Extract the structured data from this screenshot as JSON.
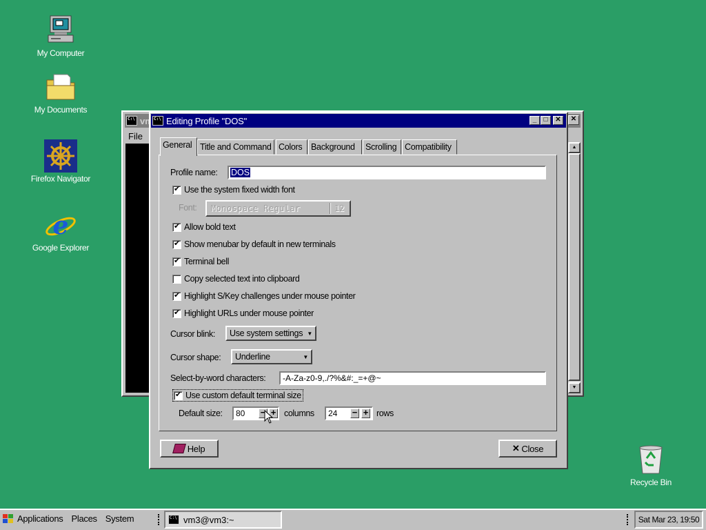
{
  "desktop": {
    "icons": [
      {
        "label": "My Computer",
        "icon": "computer-icon"
      },
      {
        "label": "My Documents",
        "icon": "folder-icon"
      },
      {
        "label": "Firefox Navigator",
        "icon": "ship-wheel-icon"
      },
      {
        "label": "Google Explorer",
        "icon": "ie-icon"
      },
      {
        "label": "Recycle Bin",
        "icon": "recycle-bin-icon"
      }
    ]
  },
  "bg_window": {
    "title": "vm",
    "menu_file": "File"
  },
  "dialog": {
    "title": "Editing Profile \"DOS\"",
    "tabs": [
      "General",
      "Title and Command",
      "Colors",
      "Background",
      "Scrolling",
      "Compatibility"
    ],
    "active_tab": "General",
    "profile_name_label": "Profile name:",
    "profile_name_value": "DOS",
    "use_system_font": {
      "label": "Use the system fixed width font",
      "checked": true
    },
    "font_label": "Font:",
    "font_value": "Monospace Regular",
    "font_size": "12",
    "allow_bold": {
      "label": "Allow bold text",
      "checked": true
    },
    "show_menubar": {
      "label": "Show menubar by default in new terminals",
      "checked": true
    },
    "terminal_bell": {
      "label": "Terminal bell",
      "checked": true
    },
    "copy_clipboard": {
      "label": "Copy selected text into clipboard",
      "checked": false
    },
    "highlight_skey": {
      "label": "Highlight S/Key challenges under mouse pointer",
      "checked": true
    },
    "highlight_urls": {
      "label": "Highlight URLs under mouse pointer",
      "checked": true
    },
    "cursor_blink_label": "Cursor blink:",
    "cursor_blink_value": "Use system settings",
    "cursor_shape_label": "Cursor shape:",
    "cursor_shape_value": "Underline",
    "select_word_label": "Select-by-word characters:",
    "select_word_value": "-A-Za-z0-9,./?%&#:_=+@~",
    "custom_size": {
      "label": "Use custom default terminal size",
      "checked": true
    },
    "default_size_label": "Default size:",
    "columns_value": "80",
    "columns_label": "columns",
    "rows_value": "24",
    "rows_label": "rows",
    "help_button": "Help",
    "close_button": "Close"
  },
  "taskbar": {
    "applications": "Applications",
    "places": "Places",
    "system": "System",
    "task_label": "vm3@vm3:~",
    "clock": "Sat Mar 23, 19:50"
  },
  "colors": {
    "desktop": "#2a9e66",
    "title_active": "#000080",
    "title_inactive": "#808080"
  }
}
